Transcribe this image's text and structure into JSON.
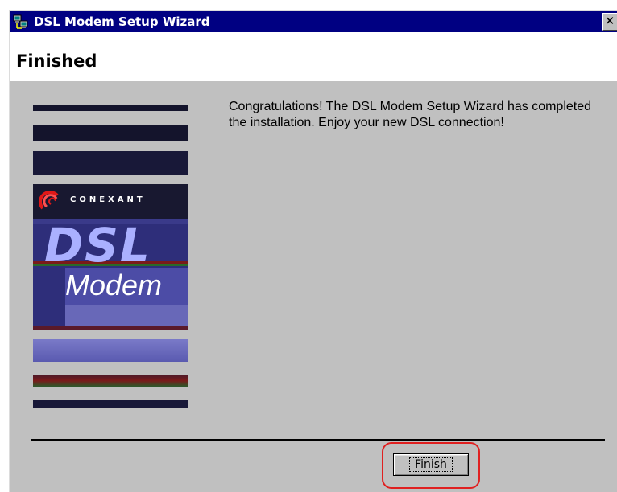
{
  "window": {
    "title": "DSL Modem Setup Wizard",
    "close_glyph": "✕",
    "icon": "network-computers-icon"
  },
  "header": {
    "title": "Finished"
  },
  "logo": {
    "brand": "CONEXANT",
    "product_line1": "DSL",
    "product_line2": "Modem"
  },
  "message": {
    "text": "Congratulations!  The DSL Modem Setup Wizard has completed the installation.  Enjoy your new DSL connection!"
  },
  "buttons": {
    "finish_access_key": "F",
    "finish_rest": "inish"
  },
  "colors": {
    "titlebar": "#000082",
    "dialog_face": "#c0c0c0",
    "stripe_dark": "#1a1a3a",
    "highlight": "#e02020"
  }
}
